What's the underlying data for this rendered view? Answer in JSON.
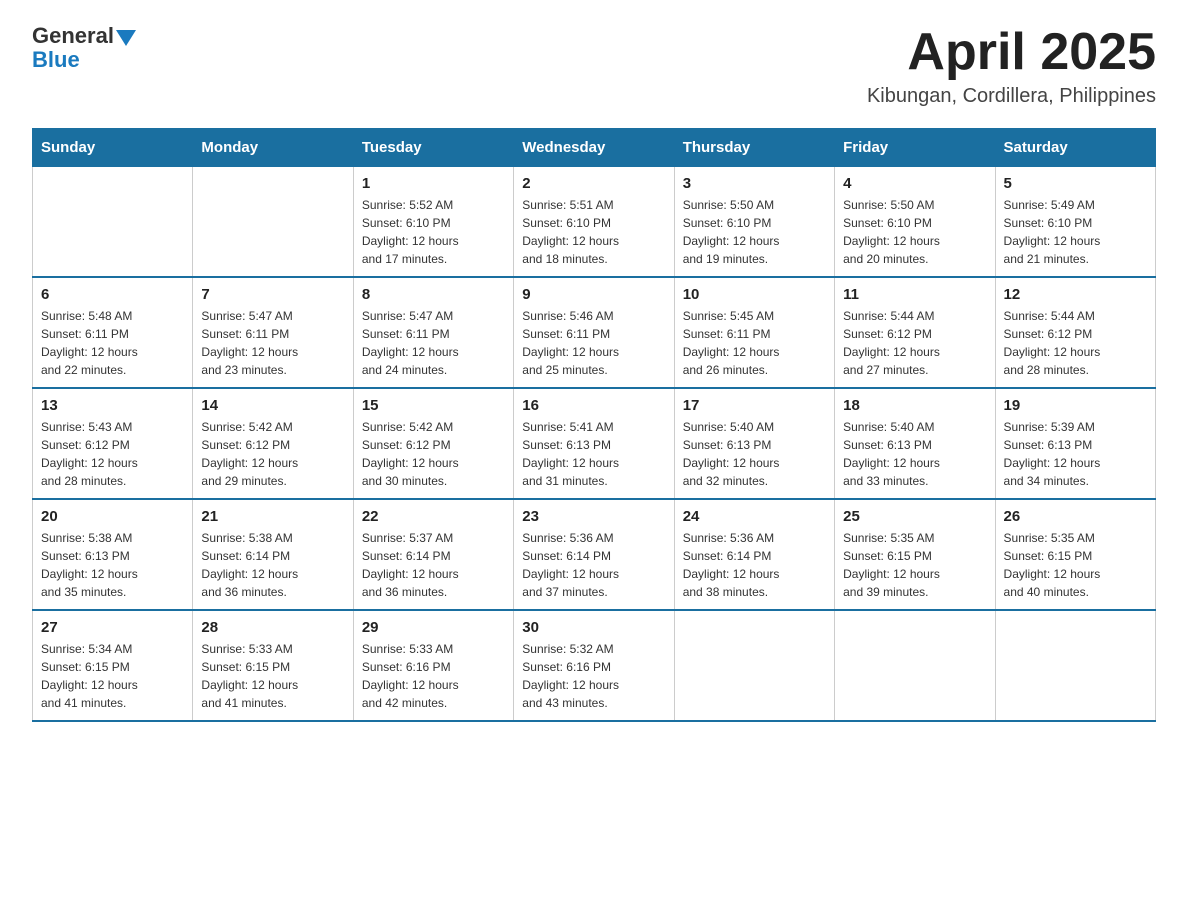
{
  "logo": {
    "general": "General",
    "blue": "Blue"
  },
  "title": "April 2025",
  "subtitle": "Kibungan, Cordillera, Philippines",
  "weekdays": [
    "Sunday",
    "Monday",
    "Tuesday",
    "Wednesday",
    "Thursday",
    "Friday",
    "Saturday"
  ],
  "weeks": [
    [
      {
        "day": "",
        "info": ""
      },
      {
        "day": "",
        "info": ""
      },
      {
        "day": "1",
        "info": "Sunrise: 5:52 AM\nSunset: 6:10 PM\nDaylight: 12 hours\nand 17 minutes."
      },
      {
        "day": "2",
        "info": "Sunrise: 5:51 AM\nSunset: 6:10 PM\nDaylight: 12 hours\nand 18 minutes."
      },
      {
        "day": "3",
        "info": "Sunrise: 5:50 AM\nSunset: 6:10 PM\nDaylight: 12 hours\nand 19 minutes."
      },
      {
        "day": "4",
        "info": "Sunrise: 5:50 AM\nSunset: 6:10 PM\nDaylight: 12 hours\nand 20 minutes."
      },
      {
        "day": "5",
        "info": "Sunrise: 5:49 AM\nSunset: 6:10 PM\nDaylight: 12 hours\nand 21 minutes."
      }
    ],
    [
      {
        "day": "6",
        "info": "Sunrise: 5:48 AM\nSunset: 6:11 PM\nDaylight: 12 hours\nand 22 minutes."
      },
      {
        "day": "7",
        "info": "Sunrise: 5:47 AM\nSunset: 6:11 PM\nDaylight: 12 hours\nand 23 minutes."
      },
      {
        "day": "8",
        "info": "Sunrise: 5:47 AM\nSunset: 6:11 PM\nDaylight: 12 hours\nand 24 minutes."
      },
      {
        "day": "9",
        "info": "Sunrise: 5:46 AM\nSunset: 6:11 PM\nDaylight: 12 hours\nand 25 minutes."
      },
      {
        "day": "10",
        "info": "Sunrise: 5:45 AM\nSunset: 6:11 PM\nDaylight: 12 hours\nand 26 minutes."
      },
      {
        "day": "11",
        "info": "Sunrise: 5:44 AM\nSunset: 6:12 PM\nDaylight: 12 hours\nand 27 minutes."
      },
      {
        "day": "12",
        "info": "Sunrise: 5:44 AM\nSunset: 6:12 PM\nDaylight: 12 hours\nand 28 minutes."
      }
    ],
    [
      {
        "day": "13",
        "info": "Sunrise: 5:43 AM\nSunset: 6:12 PM\nDaylight: 12 hours\nand 28 minutes."
      },
      {
        "day": "14",
        "info": "Sunrise: 5:42 AM\nSunset: 6:12 PM\nDaylight: 12 hours\nand 29 minutes."
      },
      {
        "day": "15",
        "info": "Sunrise: 5:42 AM\nSunset: 6:12 PM\nDaylight: 12 hours\nand 30 minutes."
      },
      {
        "day": "16",
        "info": "Sunrise: 5:41 AM\nSunset: 6:13 PM\nDaylight: 12 hours\nand 31 minutes."
      },
      {
        "day": "17",
        "info": "Sunrise: 5:40 AM\nSunset: 6:13 PM\nDaylight: 12 hours\nand 32 minutes."
      },
      {
        "day": "18",
        "info": "Sunrise: 5:40 AM\nSunset: 6:13 PM\nDaylight: 12 hours\nand 33 minutes."
      },
      {
        "day": "19",
        "info": "Sunrise: 5:39 AM\nSunset: 6:13 PM\nDaylight: 12 hours\nand 34 minutes."
      }
    ],
    [
      {
        "day": "20",
        "info": "Sunrise: 5:38 AM\nSunset: 6:13 PM\nDaylight: 12 hours\nand 35 minutes."
      },
      {
        "day": "21",
        "info": "Sunrise: 5:38 AM\nSunset: 6:14 PM\nDaylight: 12 hours\nand 36 minutes."
      },
      {
        "day": "22",
        "info": "Sunrise: 5:37 AM\nSunset: 6:14 PM\nDaylight: 12 hours\nand 36 minutes."
      },
      {
        "day": "23",
        "info": "Sunrise: 5:36 AM\nSunset: 6:14 PM\nDaylight: 12 hours\nand 37 minutes."
      },
      {
        "day": "24",
        "info": "Sunrise: 5:36 AM\nSunset: 6:14 PM\nDaylight: 12 hours\nand 38 minutes."
      },
      {
        "day": "25",
        "info": "Sunrise: 5:35 AM\nSunset: 6:15 PM\nDaylight: 12 hours\nand 39 minutes."
      },
      {
        "day": "26",
        "info": "Sunrise: 5:35 AM\nSunset: 6:15 PM\nDaylight: 12 hours\nand 40 minutes."
      }
    ],
    [
      {
        "day": "27",
        "info": "Sunrise: 5:34 AM\nSunset: 6:15 PM\nDaylight: 12 hours\nand 41 minutes."
      },
      {
        "day": "28",
        "info": "Sunrise: 5:33 AM\nSunset: 6:15 PM\nDaylight: 12 hours\nand 41 minutes."
      },
      {
        "day": "29",
        "info": "Sunrise: 5:33 AM\nSunset: 6:16 PM\nDaylight: 12 hours\nand 42 minutes."
      },
      {
        "day": "30",
        "info": "Sunrise: 5:32 AM\nSunset: 6:16 PM\nDaylight: 12 hours\nand 43 minutes."
      },
      {
        "day": "",
        "info": ""
      },
      {
        "day": "",
        "info": ""
      },
      {
        "day": "",
        "info": ""
      }
    ]
  ]
}
